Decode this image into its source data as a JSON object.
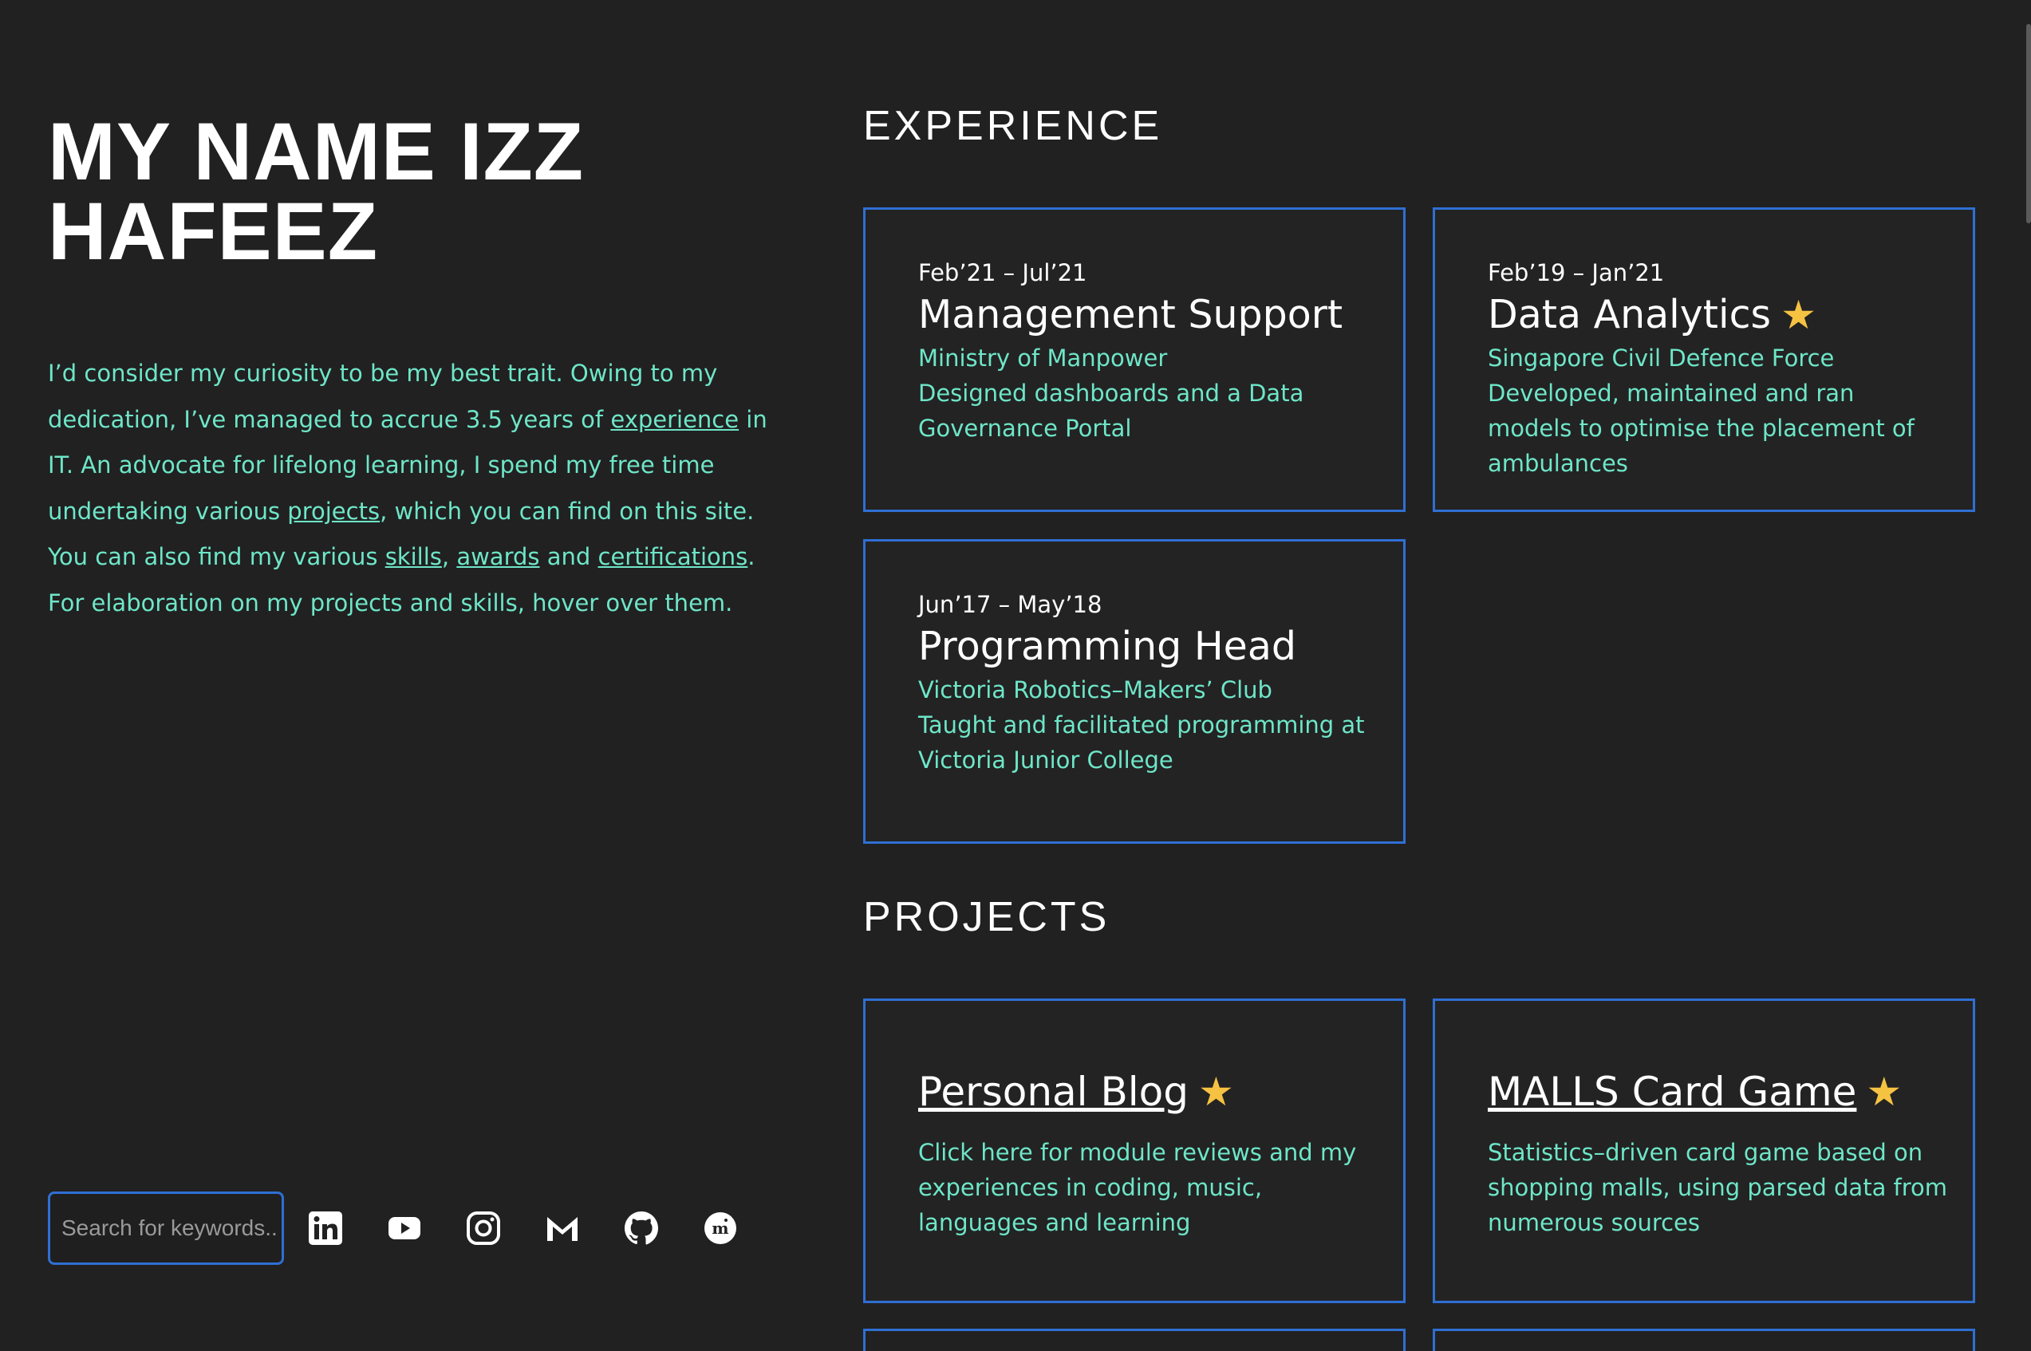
{
  "profile": {
    "name": "MY NAME IZZ HAFEEZ",
    "intro": {
      "p1": "I’d consider my curiosity to be my best trait. Owing to my dedication, I’ve managed to accrue 3.5 years of ",
      "link_experience": "experience",
      "p2": " in IT. An advocate for lifelong learning, I spend my free time undertaking various ",
      "link_projects": "projects",
      "p3": ", which you can find on this site. You can also find my various ",
      "link_skills": "skills",
      "p4": ", ",
      "link_awards": "awards",
      "p5": " and ",
      "link_certifications": "certifications",
      "p6": ". For elaboration on my projects and skills, hover over them."
    }
  },
  "search": {
    "placeholder": "Search for keywords..."
  },
  "social_icons": [
    "linkedin-icon",
    "youtube-icon",
    "instagram-icon",
    "gmail-icon",
    "github-icon",
    "medium-icon"
  ],
  "experience": {
    "heading": "EXPERIENCE",
    "items": [
      {
        "date": "Feb’21 – Jul’21",
        "role": "Management Support",
        "org": "Ministry of Manpower",
        "desc": "Designed dashboards and a Data Governance Portal",
        "starred": false
      },
      {
        "date": "Feb’19 – Jan’21",
        "role": "Data Analytics",
        "org": "Singapore Civil Defence Force",
        "desc": "Developed, maintained and ran models to optimise the placement of ambulances",
        "starred": true
      },
      {
        "date": "Jun’17 – May’18",
        "role": "Programming Head",
        "org": "Victoria Robotics–Makers’ Club",
        "desc": "Taught and facilitated programming at Victoria Junior College",
        "starred": false
      }
    ]
  },
  "projects": {
    "heading": "PROJECTS",
    "items": [
      {
        "title": "Personal Blog",
        "desc": "Click here for module reviews and my experiences in coding, music, languages and learning",
        "starred": true
      },
      {
        "title": "MALLS Card Game",
        "desc": "Statistics–driven card game based on shopping malls, using parsed data from numerous sources",
        "starred": true
      }
    ]
  },
  "star_symbol": "★",
  "colors": {
    "background": "#212121",
    "accent_border": "#2f6fd4",
    "body_text": "#6ee6c8",
    "star": "#f5c242",
    "heading": "#ffffff"
  }
}
